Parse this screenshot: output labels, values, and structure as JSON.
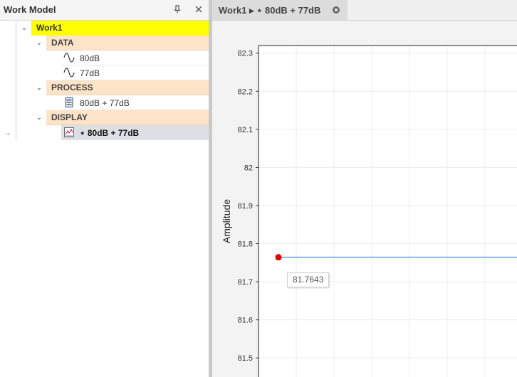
{
  "left_panel": {
    "title": "Work Model",
    "tree": {
      "root": "Work1",
      "groups": [
        {
          "label": "DATA",
          "items": [
            {
              "label": "80dB",
              "icon": "signal-wave-icon"
            },
            {
              "label": "77dB",
              "icon": "signal-wave-icon"
            }
          ]
        },
        {
          "label": "PROCESS",
          "items": [
            {
              "label": "80dB + 77dB",
              "icon": "calculator-icon"
            }
          ]
        },
        {
          "label": "DISPLAY",
          "items": [
            {
              "label": "⋆ 80dB + 77dB",
              "icon": "chart-icon"
            }
          ]
        }
      ]
    }
  },
  "tab": {
    "label": "Work1 ▸ ⋆ 80dB + 77dB"
  },
  "colors": {
    "root_highlight": "#ffff00",
    "group_background": "#fde3c8",
    "selected_row": "#dcdfe3",
    "series_line": "#5aa0d6",
    "marker": "#e00000"
  },
  "chart_data": {
    "type": "line",
    "ylabel": "Amplitude",
    "ylim": [
      81.45,
      82.32
    ],
    "yticks": [
      "82.3",
      "82.2",
      "82.1",
      "82",
      "81.9",
      "81.8",
      "81.7",
      "81.6",
      "81.5"
    ],
    "grid": true,
    "series": [
      {
        "values": [
          81.7643,
          81.7643
        ]
      }
    ],
    "marker": {
      "value": 81.7643,
      "label": "81.7643"
    }
  }
}
